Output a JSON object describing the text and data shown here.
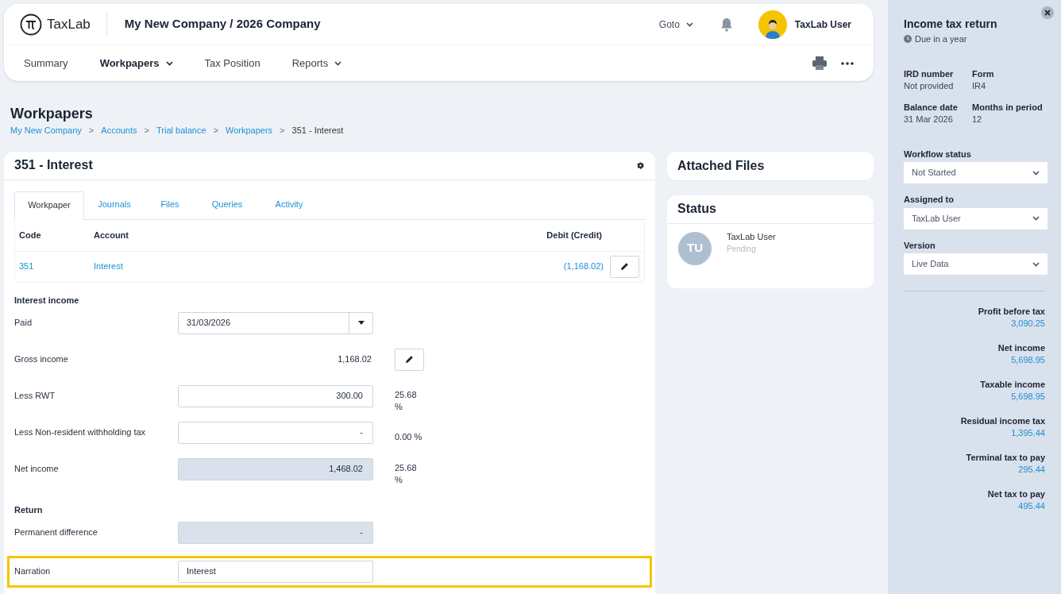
{
  "header": {
    "logo_text": "TaxLab",
    "company": "My New Company / 2026 Company",
    "goto": "Goto",
    "user": "TaxLab User"
  },
  "nav": [
    {
      "label": "Summary",
      "selected": false,
      "dropdown": false
    },
    {
      "label": "Workpapers",
      "selected": true,
      "dropdown": true
    },
    {
      "label": "Tax Position",
      "selected": false,
      "dropdown": false
    },
    {
      "label": "Reports",
      "selected": false,
      "dropdown": true
    }
  ],
  "page": {
    "title": "Workpapers",
    "breadcrumb_separator": ">",
    "breadcrumb": [
      {
        "label": "My New Company",
        "link": true
      },
      {
        "label": "Accounts",
        "link": true
      },
      {
        "label": "Trial balance",
        "link": true
      },
      {
        "label": "Workpapers",
        "link": true
      },
      {
        "label": "351 - Interest",
        "link": false
      }
    ]
  },
  "workpaper": {
    "title": "351 - Interest",
    "tabs": [
      {
        "label": "Workpaper",
        "selected": true
      },
      {
        "label": "Journals",
        "selected": false
      },
      {
        "label": "Files",
        "selected": false
      },
      {
        "label": "Queries",
        "selected": false
      },
      {
        "label": "Activity",
        "selected": false
      }
    ],
    "columns": [
      "Code",
      "Account",
      "Debit (Credit)"
    ],
    "rows": [
      {
        "code": "351",
        "account": "Interest",
        "amount": "(1,168.02)"
      }
    ],
    "form": [
      {
        "kind": "heading",
        "label": "Interest income"
      },
      {
        "kind": "date",
        "label": "Paid",
        "value": "31/03/2026"
      },
      {
        "kind": "static",
        "label": "Gross income",
        "value": "1,168.02"
      },
      {
        "kind": "input",
        "label": "Less RWT",
        "value": "300.00",
        "percent": "25.68 %"
      },
      {
        "kind": "input",
        "label": "Less Non-resident withholding tax",
        "value": "-",
        "percent": "0.00 %"
      },
      {
        "kind": "readonly",
        "label": "Net income",
        "value": "1,468.02",
        "percent": "25.68 %"
      },
      {
        "kind": "heading",
        "label": "Return"
      },
      {
        "kind": "readonly",
        "label": "Permanent difference",
        "value": "-"
      },
      {
        "kind": "text",
        "label": "Narration",
        "value": "Interest",
        "highlighted": true
      }
    ]
  },
  "attached_files": {
    "title": "Attached Files"
  },
  "status": {
    "title": "Status",
    "entries": [
      {
        "initials": "TU",
        "name": "TaxLab User",
        "state": "Pending"
      }
    ]
  },
  "side_panel": {
    "title": "Income tax return",
    "due": "Due in a year",
    "details": [
      {
        "label": "IRD number",
        "value": "Not provided"
      },
      {
        "label": "Form",
        "value": "IR4"
      },
      {
        "label": "Balance date",
        "value": "31 Mar 2026"
      },
      {
        "label": "Months in period",
        "value": "12"
      }
    ],
    "selects": [
      {
        "label": "Workflow status",
        "value": "Not Started"
      },
      {
        "label": "Assigned to",
        "value": "TaxLab User"
      },
      {
        "label": "Version",
        "value": "Live Data"
      }
    ],
    "summary": [
      {
        "label": "Profit before tax",
        "value": "3,090.25"
      },
      {
        "label": "Net income",
        "value": "5,698.95"
      },
      {
        "label": "Taxable income",
        "value": "5,698.95"
      },
      {
        "label": "Residual income tax",
        "value": "1,395.44"
      },
      {
        "label": "Terminal tax to pay",
        "value": "295.44"
      },
      {
        "label": "Net tax to pay",
        "value": "495.44"
      }
    ]
  }
}
